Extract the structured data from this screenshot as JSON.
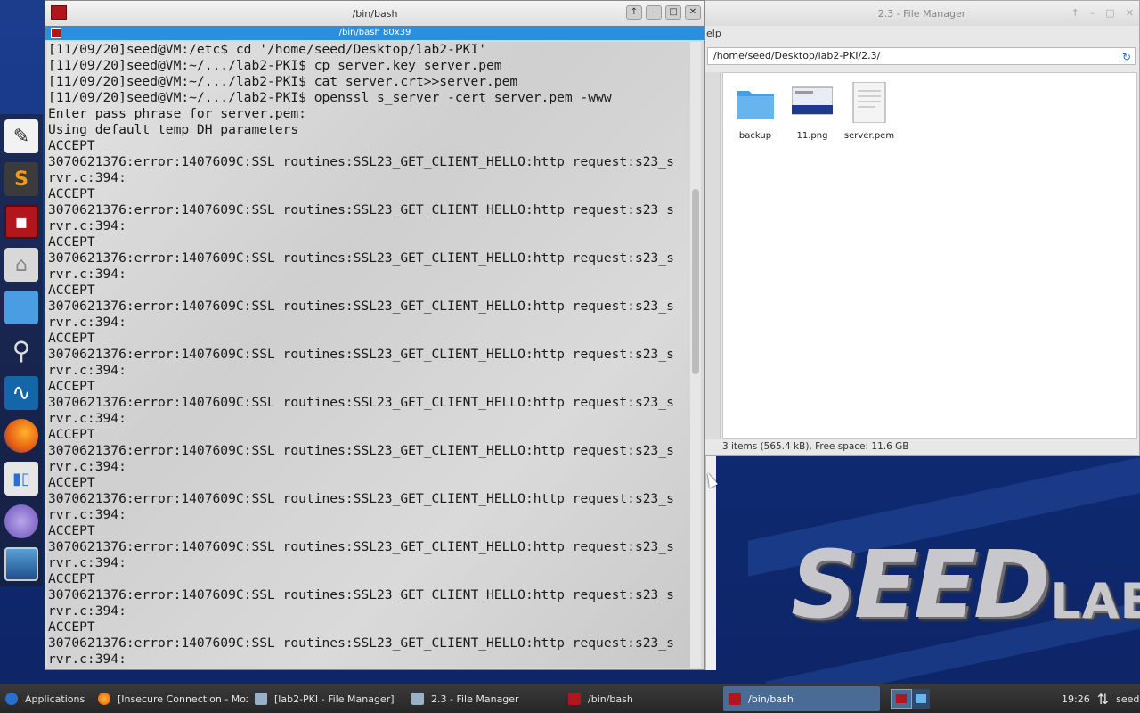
{
  "terminal": {
    "window_title": "/bin/bash",
    "tab_title": "/bin/bash 80x39",
    "lines": [
      "[11/09/20]seed@VM:/etc$ cd '/home/seed/Desktop/lab2-PKI'",
      "[11/09/20]seed@VM:~/.../lab2-PKI$ cp server.key server.pem",
      "[11/09/20]seed@VM:~/.../lab2-PKI$ cat server.crt>>server.pem",
      "[11/09/20]seed@VM:~/.../lab2-PKI$ openssl s_server -cert server.pem -www",
      "Enter pass phrase for server.pem:",
      "Using default temp DH parameters",
      "ACCEPT",
      "3070621376:error:1407609C:SSL routines:SSL23_GET_CLIENT_HELLO:http request:s23_s",
      "rvr.c:394:",
      "ACCEPT",
      "3070621376:error:1407609C:SSL routines:SSL23_GET_CLIENT_HELLO:http request:s23_s",
      "rvr.c:394:",
      "ACCEPT",
      "3070621376:error:1407609C:SSL routines:SSL23_GET_CLIENT_HELLO:http request:s23_s",
      "rvr.c:394:",
      "ACCEPT",
      "3070621376:error:1407609C:SSL routines:SSL23_GET_CLIENT_HELLO:http request:s23_s",
      "rvr.c:394:",
      "ACCEPT",
      "3070621376:error:1407609C:SSL routines:SSL23_GET_CLIENT_HELLO:http request:s23_s",
      "rvr.c:394:",
      "ACCEPT",
      "3070621376:error:1407609C:SSL routines:SSL23_GET_CLIENT_HELLO:http request:s23_s",
      "rvr.c:394:",
      "ACCEPT",
      "3070621376:error:1407609C:SSL routines:SSL23_GET_CLIENT_HELLO:http request:s23_s",
      "rvr.c:394:",
      "ACCEPT",
      "3070621376:error:1407609C:SSL routines:SSL23_GET_CLIENT_HELLO:http request:s23_s",
      "rvr.c:394:",
      "ACCEPT",
      "3070621376:error:1407609C:SSL routines:SSL23_GET_CLIENT_HELLO:http request:s23_s",
      "rvr.c:394:",
      "ACCEPT",
      "3070621376:error:1407609C:SSL routines:SSL23_GET_CLIENT_HELLO:http request:s23_s",
      "rvr.c:394:",
      "ACCEPT",
      "3070621376:error:1407609C:SSL routines:SSL23_GET_CLIENT_HELLO:http request:s23_s",
      "rvr.c:394:"
    ]
  },
  "file_manager": {
    "window_title": "2.3 - File Manager",
    "menu_fragment": "elp",
    "path": "/home/seed/Desktop/lab2-PKI/2.3/",
    "files": [
      {
        "name": "backup",
        "type": "folder"
      },
      {
        "name": "11.png",
        "type": "image"
      },
      {
        "name": "server.pem",
        "type": "document"
      }
    ],
    "status": "3 items (565.4 kB), Free space: 11.6 GB"
  },
  "desktop": {
    "logo_big": "SEED",
    "logo_small": "LABS"
  },
  "dock": {
    "items": [
      {
        "name": "text-editor-icon"
      },
      {
        "name": "sublime-icon"
      },
      {
        "name": "terminal-icon"
      },
      {
        "name": "home-folder-icon"
      },
      {
        "name": "folder-icon"
      },
      {
        "name": "search-icon"
      },
      {
        "name": "wireshark-icon"
      },
      {
        "name": "firefox-icon"
      },
      {
        "name": "settings-icon"
      },
      {
        "name": "network-icon"
      },
      {
        "name": "desktop-icon"
      }
    ]
  },
  "taskbar": {
    "applications_label": "Applications",
    "tasks": [
      {
        "label": "[Insecure Connection - Moz...",
        "icon": "firefox-icon"
      },
      {
        "label": "[lab2-PKI - File Manager]",
        "icon": "folder-icon"
      },
      {
        "label": "2.3 - File Manager",
        "icon": "folder-icon"
      },
      {
        "label": "/bin/bash",
        "icon": "terminal-icon"
      },
      {
        "label": "/bin/bash",
        "icon": "terminal-icon"
      }
    ],
    "clock": "19:26",
    "user": "seed"
  },
  "colors": {
    "terminal_tab_bar": "#2b8fe0",
    "desktop_bg": "#17378a",
    "terminal_icon_red": "#b0161c"
  }
}
